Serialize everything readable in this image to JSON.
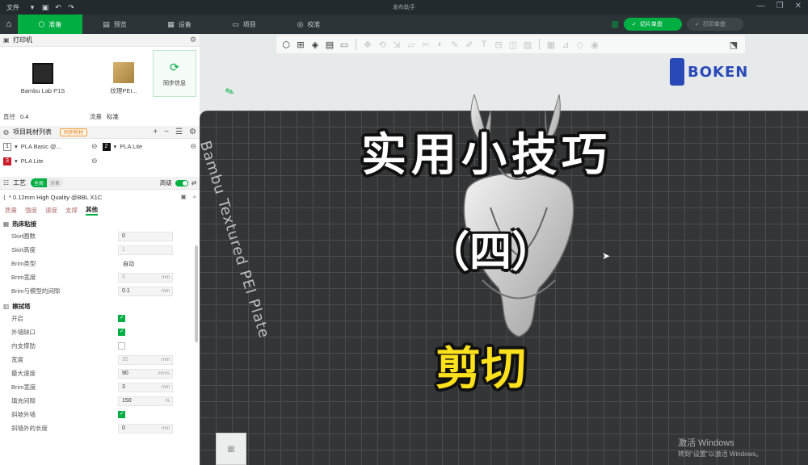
{
  "titlebar": {
    "file_label": "文件",
    "title": "发布助手"
  },
  "nav": {
    "tabs": [
      {
        "label": "准备",
        "icon": "cube-icon"
      },
      {
        "label": "预览",
        "icon": "layers-icon"
      },
      {
        "label": "设备",
        "icon": "device-icon"
      },
      {
        "label": "项目",
        "icon": "project-icon"
      },
      {
        "label": "校准",
        "icon": "calibrate-icon"
      }
    ],
    "slice_button": "切片单盘",
    "print_button": "打印单盘"
  },
  "printer": {
    "section_title": "打印机",
    "model": "Bambu Lab P1S",
    "plate": "纹理PEI...",
    "sync_label": "同步信息",
    "nozzle_label": "直径",
    "nozzle_value": "0.4",
    "flow_label": "流量",
    "flow_value": "标准"
  },
  "filament": {
    "section_title": "项目耗材列表",
    "badge": "同步耗材",
    "items": [
      {
        "num": "1",
        "name": "PLA Basic @...",
        "color": "white"
      },
      {
        "num": "2",
        "name": "PLA Lite",
        "color": "black"
      },
      {
        "num": "3",
        "name": "PLA Lite",
        "color": "red"
      }
    ]
  },
  "process": {
    "section_title": "工艺",
    "toggle_on": "全局",
    "toggle_off": "对象",
    "advanced_label": "高级",
    "preset": "* 0.12mm High Quality @BBL X1C",
    "subtabs": [
      "质量",
      "强度",
      "速度",
      "支撑",
      "其他"
    ],
    "active_subtab": "其他",
    "group1": {
      "title": "热床粘接",
      "settings": [
        {
          "label": "Skirt圈数",
          "value": "0"
        },
        {
          "label": "Skirt高度",
          "value": "1"
        },
        {
          "label": "Brim类型",
          "value": "自动"
        },
        {
          "label": "Brim宽度",
          "value": "5",
          "unit": "mm"
        },
        {
          "label": "Brim与模型的间隙",
          "value": "0.1",
          "unit": "mm"
        }
      ]
    },
    "group2": {
      "title": "擦拭塔",
      "settings": [
        {
          "label": "开启",
          "checked": true
        },
        {
          "label": "外墙缺口",
          "checked": true
        },
        {
          "label": "内支撑肋",
          "checked": false
        },
        {
          "label": "宽度",
          "value": "35",
          "unit": "mm"
        },
        {
          "label": "最大速度",
          "value": "90",
          "unit": "mm/s"
        },
        {
          "label": "Brim宽度",
          "value": "3",
          "unit": "mm"
        },
        {
          "label": "填充间隙",
          "value": "150",
          "unit": "%"
        },
        {
          "label": "斜坡外墙",
          "checked": true
        },
        {
          "label": "斜墙外的长度",
          "value": "0",
          "unit": "mm"
        }
      ]
    }
  },
  "viewport": {
    "bed_label": "Bambu Textured PEI Plate",
    "logo_text": "BOKEN",
    "overlay_title": "实用小技巧",
    "overlay_sub": "（四）",
    "overlay_cut": "剪切",
    "watermark_line1": "激活 Windows",
    "watermark_line2": "转到\"设置\"以激活 Windows。"
  }
}
